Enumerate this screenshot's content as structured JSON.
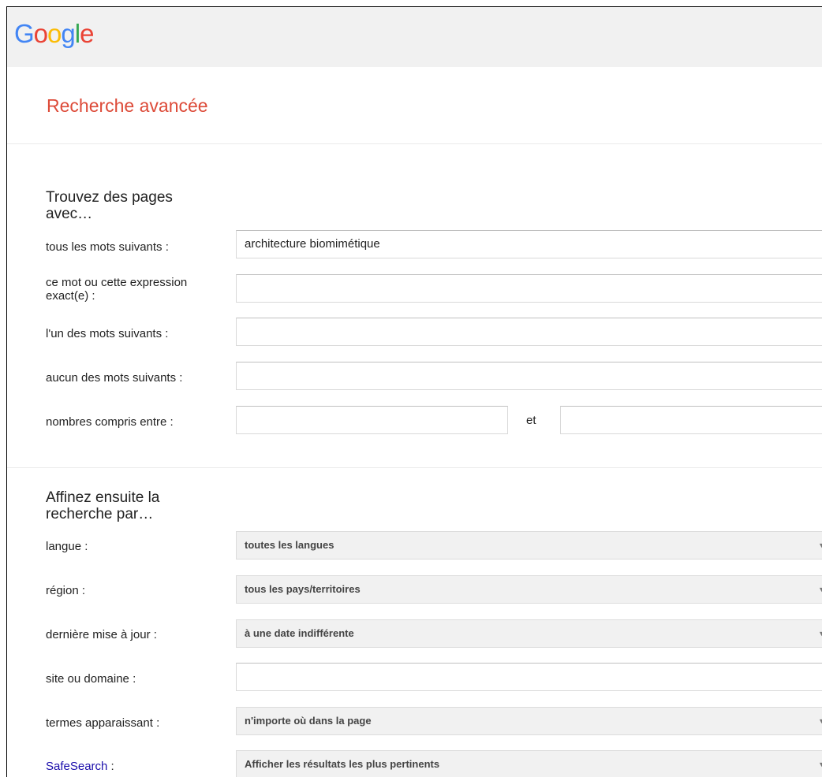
{
  "logo": {
    "letters": [
      {
        "ch": "G",
        "color": "#4285f4"
      },
      {
        "ch": "o",
        "color": "#ea4335"
      },
      {
        "ch": "o",
        "color": "#fbbc05"
      },
      {
        "ch": "g",
        "color": "#4285f4"
      },
      {
        "ch": "l",
        "color": "#34a853"
      },
      {
        "ch": "e",
        "color": "#ea4335"
      }
    ]
  },
  "page": {
    "title": "Recherche avancée"
  },
  "find": {
    "heading": "Trouvez des pages avec…",
    "all_words": {
      "label": "tous les mots suivants :",
      "value": "architecture biomimétique"
    },
    "exact": {
      "label": "ce mot ou cette expression exact(e) :",
      "value": ""
    },
    "any_words": {
      "label": "l'un des mots suivants :",
      "value": ""
    },
    "none_words": {
      "label": "aucun des mots suivants :",
      "value": ""
    },
    "numbers": {
      "label": "nombres compris entre :",
      "from": "",
      "to": "",
      "and_label": "et"
    }
  },
  "refine": {
    "heading": "Affinez ensuite la recherche par…",
    "language": {
      "label": "langue :",
      "selected": "toutes les langues"
    },
    "region": {
      "label": "région :",
      "selected": "tous les pays/territoires"
    },
    "last_update": {
      "label": "dernière mise à jour :",
      "selected": "à une date indifférente"
    },
    "site": {
      "label": "site ou domaine :",
      "value": ""
    },
    "terms": {
      "label": "termes apparaissant :",
      "selected": "n'importe où dans la page"
    },
    "safesearch": {
      "link": "SafeSearch",
      "suffix": " :",
      "selected": "Afficher les résultats les plus pertinents"
    }
  },
  "icons": {
    "dropdown": "chevron-down-icon"
  }
}
